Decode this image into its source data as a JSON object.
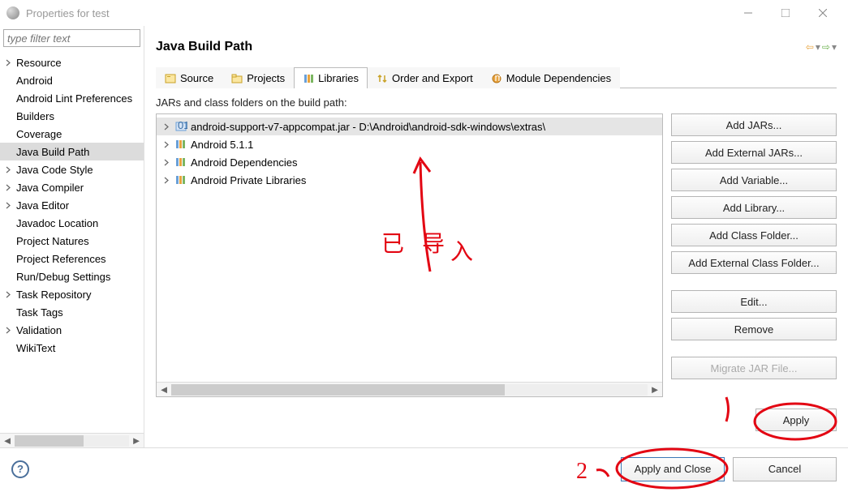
{
  "window": {
    "title": "Properties for test"
  },
  "sidebar": {
    "filter_placeholder": "type filter text",
    "items": [
      {
        "label": "Resource",
        "expandable": true,
        "selected": false
      },
      {
        "label": "Android",
        "expandable": false,
        "selected": false
      },
      {
        "label": "Android Lint Preferences",
        "expandable": false,
        "selected": false
      },
      {
        "label": "Builders",
        "expandable": false,
        "selected": false
      },
      {
        "label": "Coverage",
        "expandable": false,
        "selected": false
      },
      {
        "label": "Java Build Path",
        "expandable": false,
        "selected": true
      },
      {
        "label": "Java Code Style",
        "expandable": true,
        "selected": false
      },
      {
        "label": "Java Compiler",
        "expandable": true,
        "selected": false
      },
      {
        "label": "Java Editor",
        "expandable": true,
        "selected": false
      },
      {
        "label": "Javadoc Location",
        "expandable": false,
        "selected": false
      },
      {
        "label": "Project Natures",
        "expandable": false,
        "selected": false
      },
      {
        "label": "Project References",
        "expandable": false,
        "selected": false
      },
      {
        "label": "Run/Debug Settings",
        "expandable": false,
        "selected": false
      },
      {
        "label": "Task Repository",
        "expandable": true,
        "selected": false
      },
      {
        "label": "Task Tags",
        "expandable": false,
        "selected": false
      },
      {
        "label": "Validation",
        "expandable": true,
        "selected": false
      },
      {
        "label": "WikiText",
        "expandable": false,
        "selected": false
      }
    ]
  },
  "main": {
    "heading": "Java Build Path",
    "tabs": [
      {
        "label": "Source",
        "icon": "source"
      },
      {
        "label": "Projects",
        "icon": "projects"
      },
      {
        "label": "Libraries",
        "icon": "libraries"
      },
      {
        "label": "Order and Export",
        "icon": "order"
      },
      {
        "label": "Module Dependencies",
        "icon": "module"
      }
    ],
    "active_tab": 2,
    "subtitle": "JARs and class folders on the build path:",
    "libraries": [
      {
        "label": "android-support-v7-appcompat.jar - D:\\Android\\android-sdk-windows\\extras\\",
        "icon": "jar",
        "selected": true
      },
      {
        "label": "Android 5.1.1",
        "icon": "lib",
        "selected": false
      },
      {
        "label": "Android Dependencies",
        "icon": "lib",
        "selected": false
      },
      {
        "label": "Android Private Libraries",
        "icon": "lib",
        "selected": false
      }
    ],
    "buttons": {
      "add_jars": "Add JARs...",
      "add_ext_jars": "Add External JARs...",
      "add_variable": "Add Variable...",
      "add_library": "Add Library...",
      "add_class_folder": "Add Class Folder...",
      "add_ext_class_folder": "Add External Class Folder...",
      "edit": "Edit...",
      "remove": "Remove",
      "migrate": "Migrate JAR File...",
      "apply": "Apply"
    }
  },
  "footer": {
    "apply_close": "Apply and Close",
    "cancel": "Cancel"
  },
  "annotations": {
    "text": "已导入",
    "step2": "2"
  }
}
